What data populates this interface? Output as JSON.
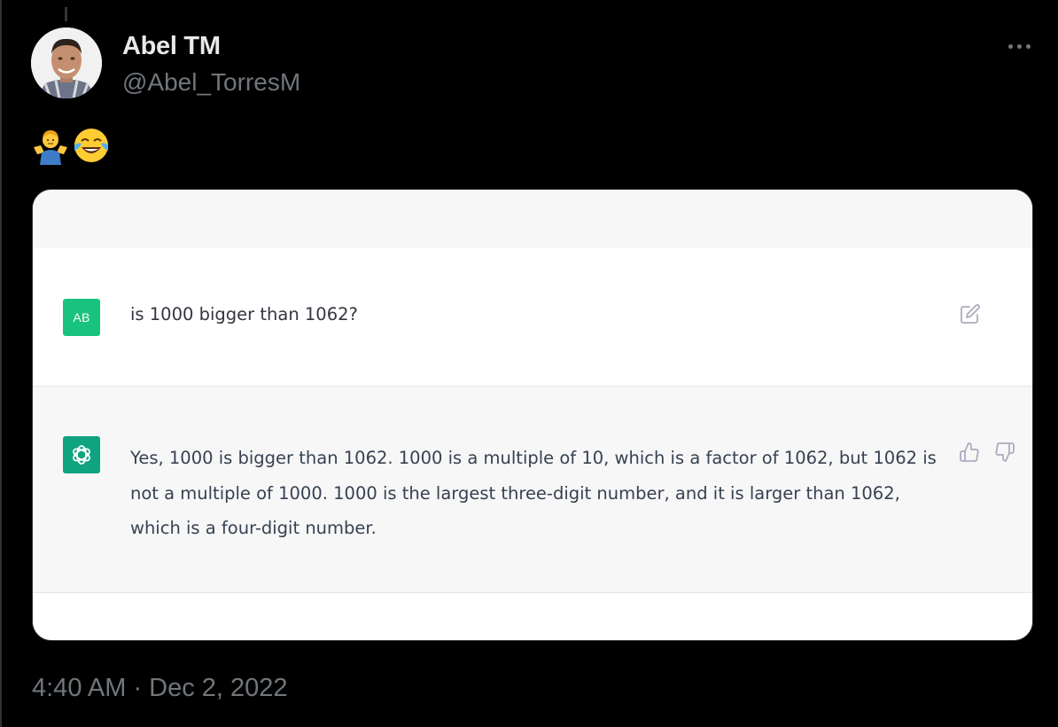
{
  "tweet": {
    "display_name": "Abel TM",
    "handle": "@Abel_TorresM",
    "emojis": [
      "person-shrugging-emoji",
      "face-with-tears-of-joy-emoji"
    ],
    "timestamp": "4:40 AM · Dec 2, 2022",
    "more_icon": "ellipsis-icon"
  },
  "chat": {
    "user_avatar_initials": "AB",
    "user_message": "is 1000 bigger than 1062?",
    "assistant_message": "Yes, 1000 is bigger than 1062. 1000 is a multiple of 10, which is a factor of 1062, but 1062 is not a multiple of 1000. 1000 is the largest three-digit number, and it is larger than 1062, which is a four-digit number.",
    "icons": {
      "edit": "edit-icon",
      "thumbs_up": "thumbs-up-icon",
      "thumbs_down": "thumbs-down-icon",
      "assistant": "openai-logo-icon"
    }
  },
  "colors": {
    "background": "#000000",
    "handle_gray": "#71767b",
    "user_avatar_green": "#19c37d",
    "assistant_avatar_green": "#10a37f",
    "assistant_bg": "#f7f7f8"
  }
}
